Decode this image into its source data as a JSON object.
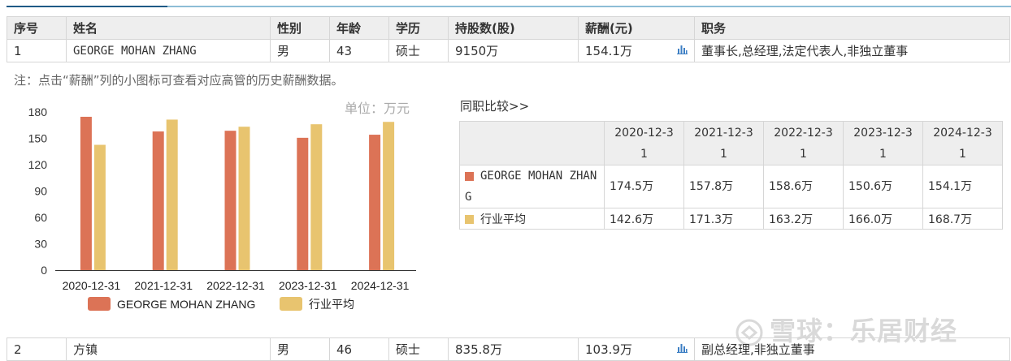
{
  "colors": {
    "accent_dark": "#1f5a86",
    "accent_light": "#8dbdd6",
    "series_person": "#dc7356",
    "series_industry": "#e8c46f",
    "bar_icon": "#3d7fc4"
  },
  "table": {
    "headers": [
      "序号",
      "姓名",
      "性别",
      "年龄",
      "学历",
      "持股数(股)",
      "薪酬(元)",
      "职务"
    ],
    "rows": [
      {
        "index": "1",
        "name": "GEORGE MOHAN ZHANG",
        "gender": "男",
        "age": "43",
        "education": "硕士",
        "shares": "9150万",
        "salary": "154.1万",
        "position": "董事长,总经理,法定代表人,非独立董事",
        "icon": "bar-chart-icon"
      },
      {
        "index": "2",
        "name": "方镇",
        "gender": "男",
        "age": "46",
        "education": "硕士",
        "shares": "835.8万",
        "salary": "103.9万",
        "position": "副总经理,非独立董事",
        "icon": "bar-chart-icon"
      }
    ]
  },
  "note": "注：点击“薪酬”列的小图标可查看对应高管的历史薪酬数据。",
  "unit_label": "单位：万元",
  "peer_title": "同职比较>>",
  "comparison": {
    "dates": [
      "2020-12-31",
      "2021-12-31",
      "2022-12-31",
      "2023-12-31",
      "2024-12-31"
    ],
    "person_label": "GEORGE MOHAN ZHANG",
    "person_values": [
      "174.5万",
      "157.8万",
      "158.6万",
      "150.6万",
      "154.1万"
    ],
    "industry_label": "行业平均",
    "industry_values": [
      "142.6万",
      "171.3万",
      "163.2万",
      "166.0万",
      "168.7万"
    ]
  },
  "chart_data": {
    "type": "bar",
    "categories": [
      "2020-12-31",
      "2021-12-31",
      "2022-12-31",
      "2023-12-31",
      "2024-12-31"
    ],
    "series": [
      {
        "name": "GEORGE MOHAN ZHANG",
        "values": [
          174.5,
          157.8,
          158.6,
          150.6,
          154.1
        ],
        "color": "#dc7356"
      },
      {
        "name": "行业平均",
        "values": [
          142.6,
          171.3,
          163.2,
          166.0,
          168.7
        ],
        "color": "#e8c46f"
      }
    ],
    "yticks": [
      0,
      30,
      60,
      90,
      120,
      150,
      180
    ],
    "ylim": [
      0,
      180
    ],
    "legend_position": "bottom",
    "grid": false
  },
  "watermark": "雪球：乐居财经"
}
